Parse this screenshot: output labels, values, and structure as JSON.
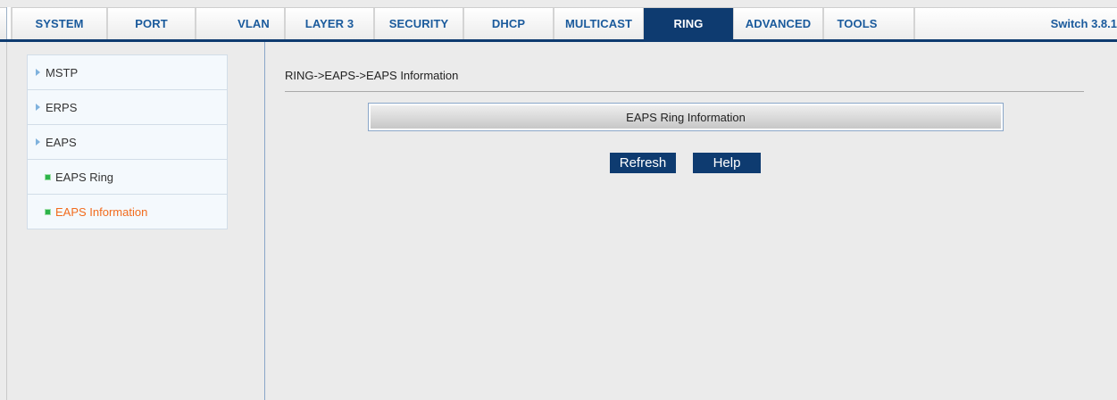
{
  "nav": {
    "tabs": [
      {
        "label": "SYSTEM"
      },
      {
        "label": "PORT"
      },
      {
        "label": "VLAN"
      },
      {
        "label": "LAYER 3"
      },
      {
        "label": "SECURITY"
      },
      {
        "label": "DHCP"
      },
      {
        "label": "MULTICAST"
      },
      {
        "label": "RING"
      },
      {
        "label": "ADVANCED"
      },
      {
        "label": "TOOLS"
      }
    ],
    "active_tab": "RING",
    "version": "Switch 3.8.1"
  },
  "sidebar": {
    "items": [
      {
        "label": "MSTP"
      },
      {
        "label": "ERPS"
      },
      {
        "label": "EAPS"
      },
      {
        "label": "EAPS Ring"
      },
      {
        "label": "EAPS Information"
      }
    ]
  },
  "main": {
    "breadcrumb": "RING->EAPS->EAPS Information",
    "panel_title": "EAPS Ring Information",
    "refresh_label": "Refresh",
    "help_label": "Help"
  },
  "colors": {
    "brand": "#0e3b70",
    "tab_text": "#1a5a9c",
    "current_item": "#f26b1d",
    "sub_item_marker": "#2db34a"
  }
}
